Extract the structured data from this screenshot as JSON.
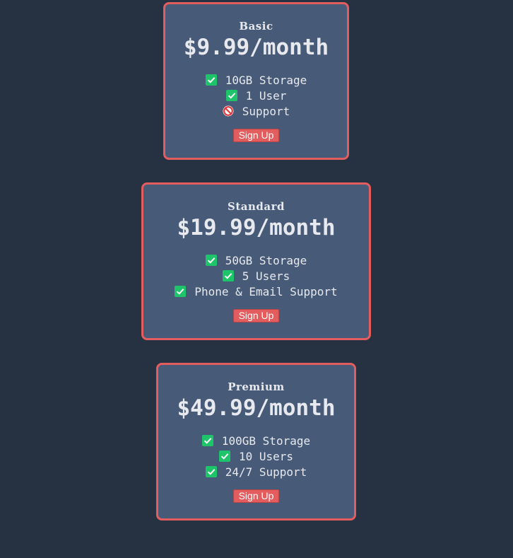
{
  "colors": {
    "page_background": "#263142",
    "card_background": "#475b78",
    "card_border": "#e35d5f",
    "button_background": "#e35d5f",
    "check_green": "#1ec46a",
    "prohibited_red": "#e03a3e"
  },
  "plans": [
    {
      "name": "Basic",
      "price": "$9.99/month",
      "features": [
        {
          "text": "10GB Storage",
          "icon": "check-icon"
        },
        {
          "text": "1 User",
          "icon": "check-icon"
        },
        {
          "text": "Support",
          "icon": "prohibited-icon"
        }
      ],
      "button_label": "Sign Up"
    },
    {
      "name": "Standard",
      "price": "$19.99/month",
      "features": [
        {
          "text": "50GB Storage",
          "icon": "check-icon"
        },
        {
          "text": "5 Users",
          "icon": "check-icon"
        },
        {
          "text": "Phone & Email Support",
          "icon": "check-icon"
        }
      ],
      "button_label": "Sign Up"
    },
    {
      "name": "Premium",
      "price": "$49.99/month",
      "features": [
        {
          "text": "100GB Storage",
          "icon": "check-icon"
        },
        {
          "text": "10 Users",
          "icon": "check-icon"
        },
        {
          "text": "24/7 Support",
          "icon": "check-icon"
        }
      ],
      "button_label": "Sign Up"
    }
  ]
}
